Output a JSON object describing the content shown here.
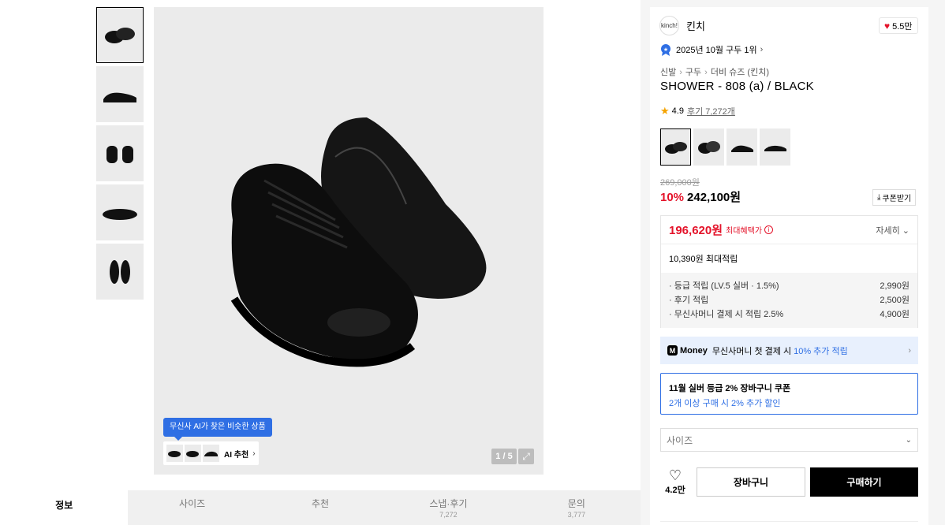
{
  "gallery": {
    "thumbnails": [
      {
        "alt_icon": "shoe-pair-top-icon"
      },
      {
        "alt_icon": "shoe-side-icon"
      },
      {
        "alt_icon": "shoe-back-icon"
      },
      {
        "alt_icon": "shoe-sole-icon"
      },
      {
        "alt_icon": "shoe-top-view-icon"
      }
    ],
    "ai_tooltip": "무신사 AI가 찾은 비슷한 상품",
    "ai_label": "AI 추천",
    "pager": "1 / 5"
  },
  "tabs": [
    {
      "label": "정보",
      "sub": ""
    },
    {
      "label": "사이즈",
      "sub": ""
    },
    {
      "label": "추천",
      "sub": ""
    },
    {
      "label": "스냅·후기",
      "sub": "7,272"
    },
    {
      "label": "문의",
      "sub": "3,777"
    }
  ],
  "product": {
    "brand_logo_text": "kinch!",
    "brand": "킨치",
    "likes": "5.5만",
    "rank": "2025년 10월 구두 1위",
    "breadcrumbs": [
      "신발",
      "구두",
      "더비 슈즈 (킨치)"
    ],
    "title": "SHOWER - 808 (a) / BLACK",
    "rating": "4.9",
    "reviews": "후기 7,272개",
    "original_price": "269,000원",
    "discount": "10%",
    "price": "242,100원",
    "coupon_label": "쿠폰받기"
  },
  "benefits": {
    "max_price": "196,620원",
    "max_label": "최대혜택가",
    "detail": "자세히",
    "max_points": "10,390원 최대적립",
    "points": [
      {
        "label": "· 등급 적립 (LV.5 실버 · 1.5%)",
        "value": "2,990원"
      },
      {
        "label": "· 후기 적립",
        "value": "2,500원"
      },
      {
        "label": "· 무신사머니 결제 시 적립 2.5%",
        "value": "4,900원"
      }
    ]
  },
  "money_banner": {
    "brand": "Money",
    "text": "무신사머니 첫 결제 시",
    "accent": "10% 추가 적립"
  },
  "silver_coupon": {
    "title": "11월 실버 등급 2% 장바구니 쿠폰",
    "sub": "2개 이상 구매 시 2% 추가 할인"
  },
  "size_select": {
    "placeholder": "사이즈"
  },
  "actions": {
    "wish_count": "4.2만",
    "cart": "장바구니",
    "buy": "구매하기"
  },
  "colors": {
    "accent_red": "#e4132a",
    "accent_blue": "#2f6fe4",
    "star": "#f5a300"
  }
}
